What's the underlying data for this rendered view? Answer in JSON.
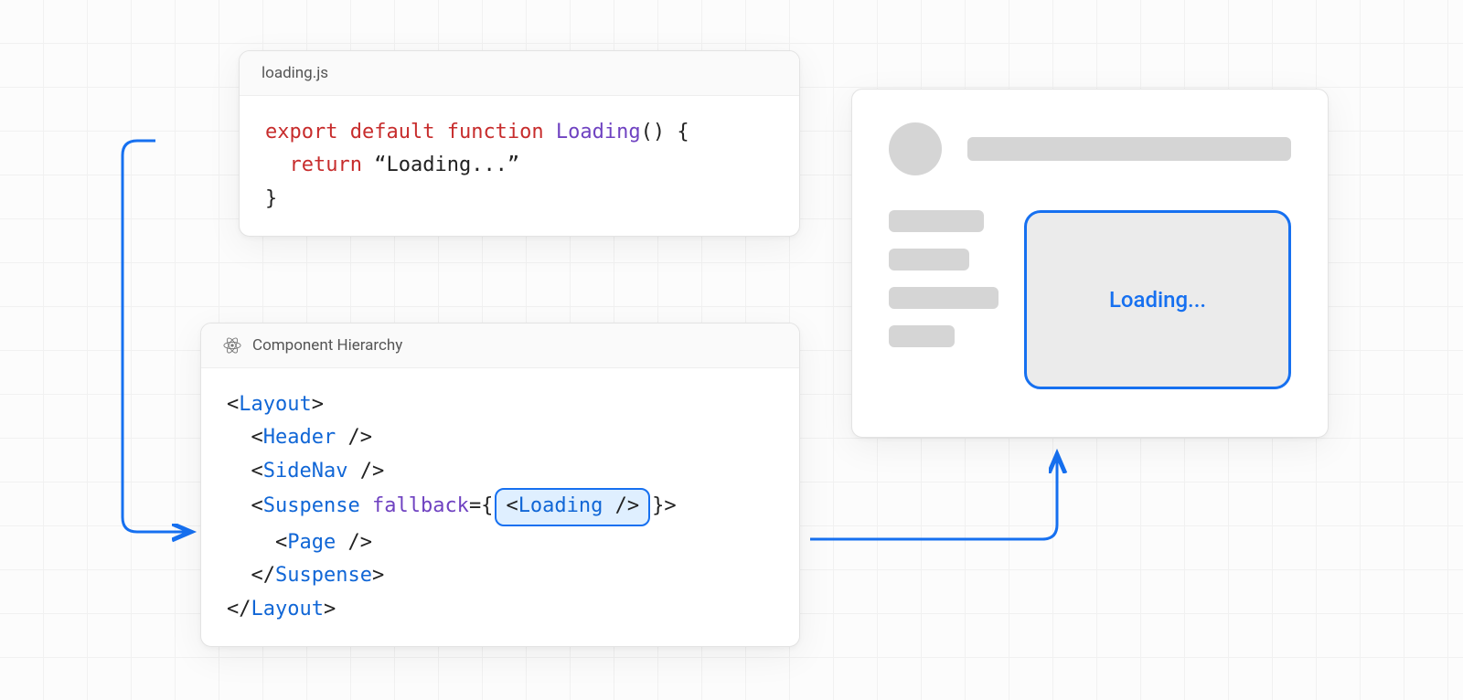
{
  "code_panel": {
    "filename": "loading.js",
    "line1_kw1": "export",
    "line1_kw2": "default",
    "line1_kw3": "function",
    "line1_fn": "Loading",
    "line1_tail": "() {",
    "line2_kw": "return",
    "line2_str": "“Loading...”",
    "line3": "}"
  },
  "hierarchy_panel": {
    "title": "Component Hierarchy",
    "l1_open": "<",
    "l1_tag": "Layout",
    "l1_close": ">",
    "l2_open": "<",
    "l2_tag": "Header",
    "l2_close": " />",
    "l3_open": "<",
    "l3_tag": "SideNav",
    "l3_close": " />",
    "l4_open": "<",
    "l4_tag": "Suspense",
    "l4_sp": " ",
    "l4_attr": "fallback",
    "l4_eq": "={",
    "l4_pill_open": "<",
    "l4_pill_tag": "Loading",
    "l4_pill_close": " />",
    "l4_tail": "}>",
    "l5_open": "<",
    "l5_tag": "Page",
    "l5_close": " />",
    "l6_open": "</",
    "l6_tag": "Suspense",
    "l6_close": ">",
    "l7_open": "</",
    "l7_tag": "Layout",
    "l7_close": ">"
  },
  "app_panel": {
    "loading_text": "Loading..."
  }
}
